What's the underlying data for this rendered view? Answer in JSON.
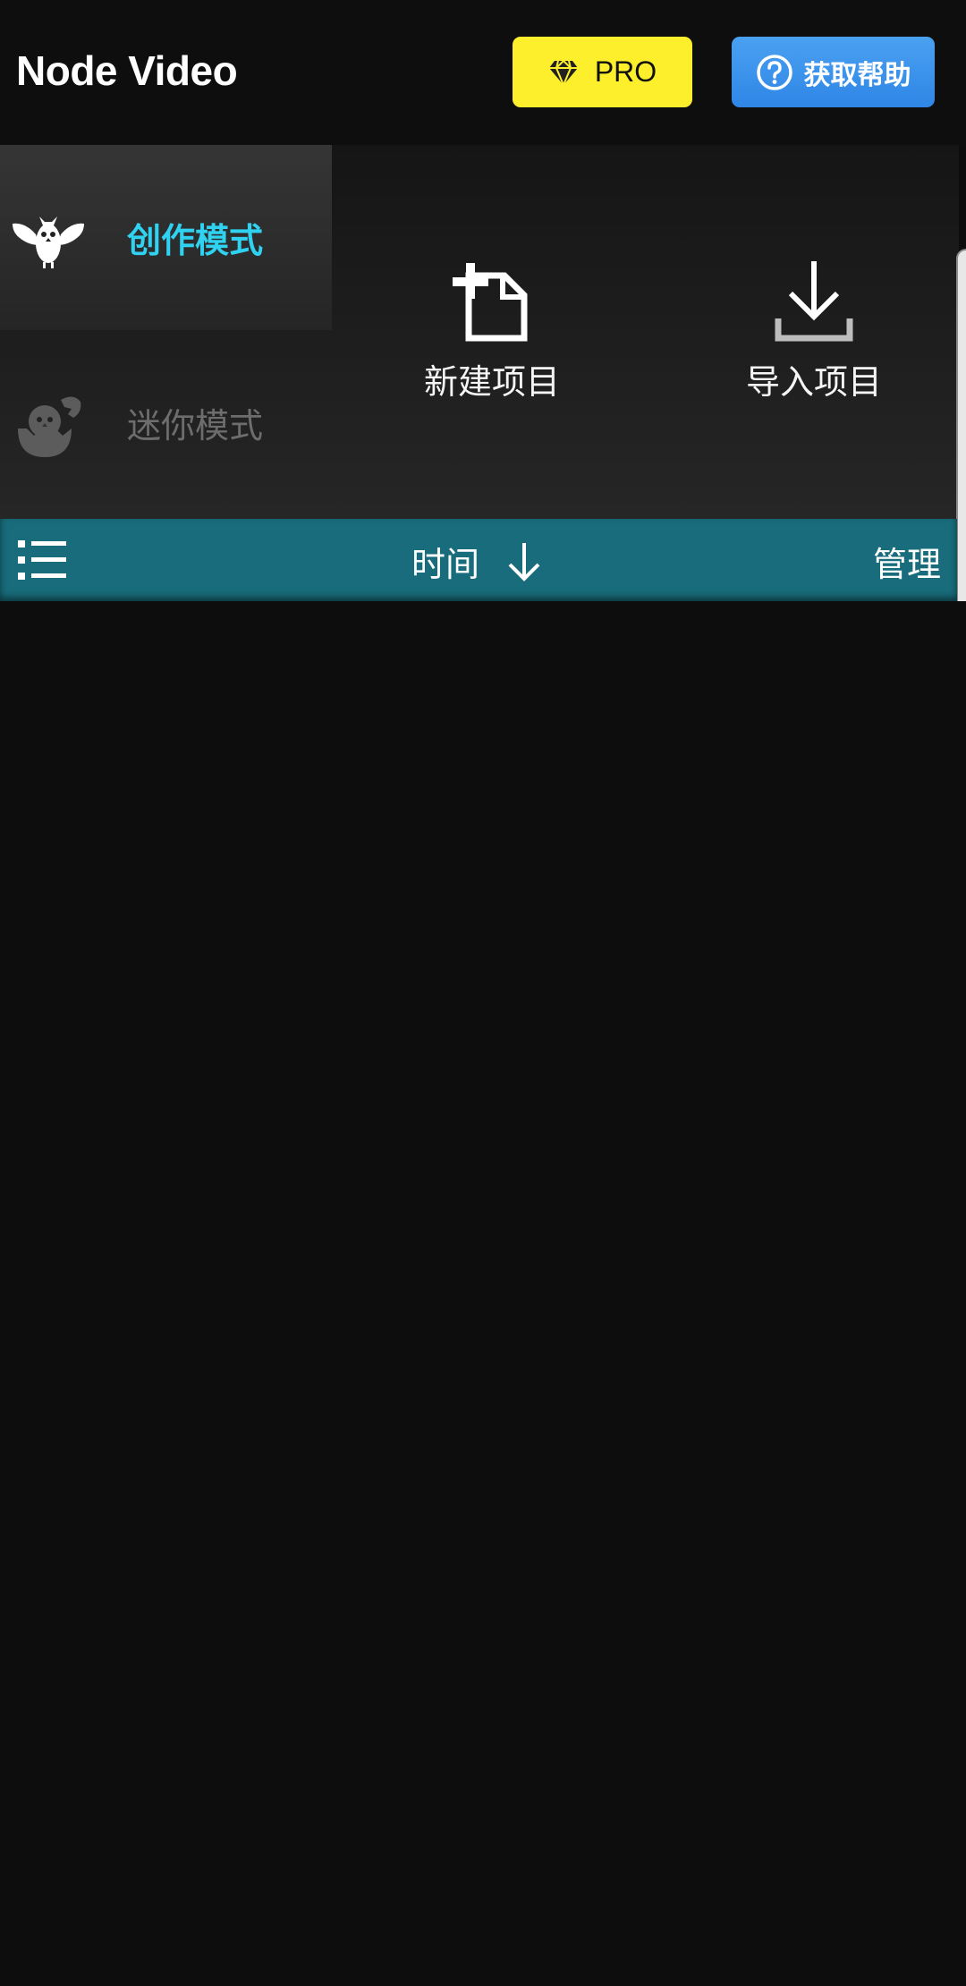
{
  "app": {
    "title": "Node Video"
  },
  "header": {
    "pro_label": "PRO",
    "help_label": "获取帮助",
    "pro_color": "#fdef2b",
    "help_color": "#3a91eb"
  },
  "modes": [
    {
      "label": "创作模式",
      "icon": "owl-icon",
      "active": true
    },
    {
      "label": "迷你模式",
      "icon": "hatching-chick-icon",
      "active": false
    }
  ],
  "actions": {
    "new_project": {
      "label": "新建项目",
      "icon": "new-file-icon"
    },
    "import_project": {
      "label": "导入项目",
      "icon": "download-icon"
    }
  },
  "toolbar": {
    "sort_label": "时间",
    "sort_icon": "arrow-down-icon",
    "manage_label": "管理",
    "list_icon": "list-icon",
    "color": "#186c7b"
  }
}
